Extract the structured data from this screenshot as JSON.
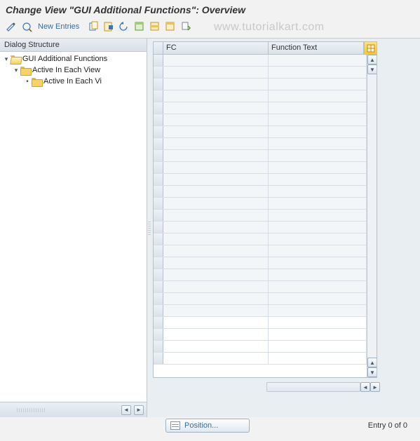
{
  "title": "Change View \"GUI Additional Functions\": Overview",
  "toolbar": {
    "new_entries_label": "New Entries"
  },
  "watermark": "www.tutorialkart.com",
  "sidebar": {
    "header": "Dialog Structure",
    "nodes": [
      {
        "label": "GUI Additional Functions"
      },
      {
        "label": "Active In Each View"
      },
      {
        "label": "Active In Each Vi"
      }
    ]
  },
  "grid": {
    "columns": {
      "fc": "FC",
      "ft": "Function Text"
    },
    "row_count": 26
  },
  "footer": {
    "position_label": "Position...",
    "entry_text": "Entry 0 of 0"
  }
}
